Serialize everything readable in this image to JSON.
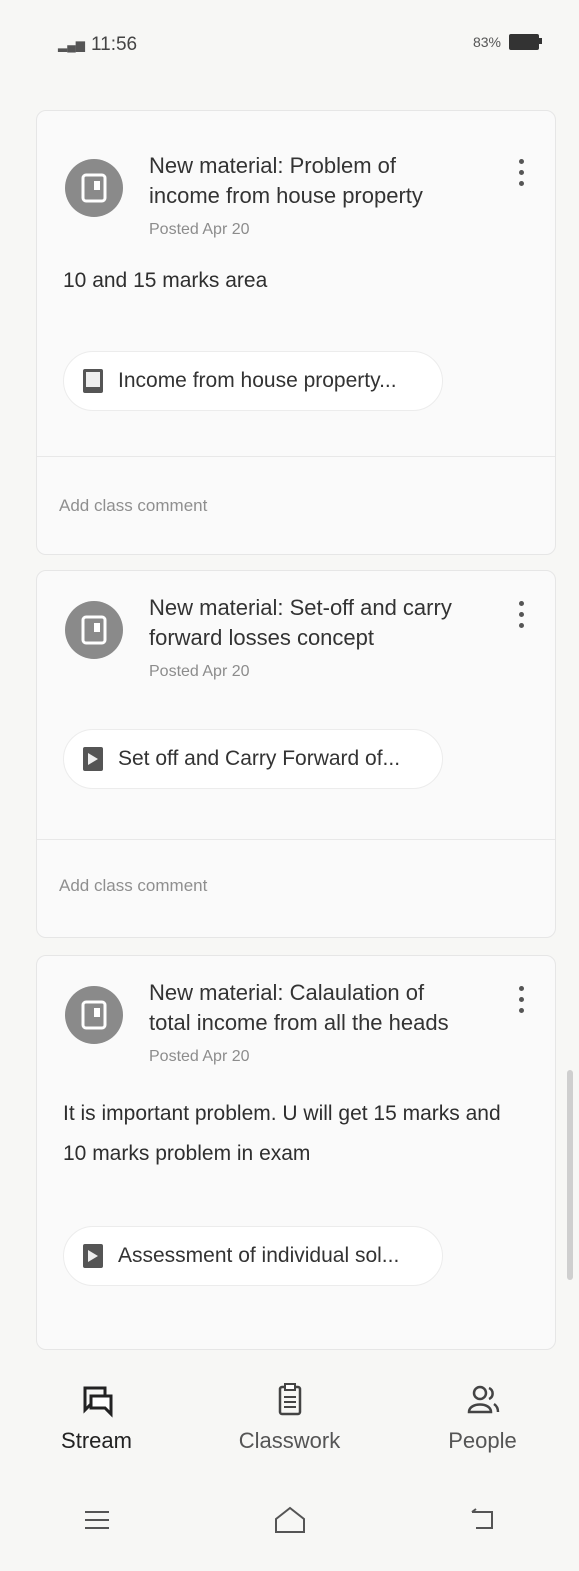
{
  "status_bar": {
    "time": "11:56",
    "battery_text": "83%"
  },
  "posts": [
    {
      "title": "New material: Problem of income from house property",
      "posted": "Posted Apr 20",
      "description": "10 and 15 marks area",
      "attachment": "Income from house property...",
      "comment_placeholder": "Add class comment"
    },
    {
      "title": "New material: Set-off and carry forward losses concept",
      "posted": "Posted Apr 20",
      "description": "",
      "attachment": "Set off and Carry Forward of...",
      "comment_placeholder": "Add class comment"
    },
    {
      "title": "New material: Calaulation of total income from all the heads",
      "posted": "Posted Apr 20",
      "description": "It is important problem. U will get 15 marks and 10 marks problem in exam",
      "attachment": "Assessment of individual sol..."
    }
  ],
  "bottom_nav": {
    "items": [
      {
        "label": "Stream",
        "icon": "stream-icon",
        "active": true
      },
      {
        "label": "Classwork",
        "icon": "classwork-icon",
        "active": false
      },
      {
        "label": "People",
        "icon": "people-icon",
        "active": false
      }
    ]
  },
  "colors": {
    "background": "#f7f7f5",
    "avatar": "#8a8a8a",
    "text_primary": "#2b2b2b",
    "text_secondary": "#8c8c8c"
  }
}
